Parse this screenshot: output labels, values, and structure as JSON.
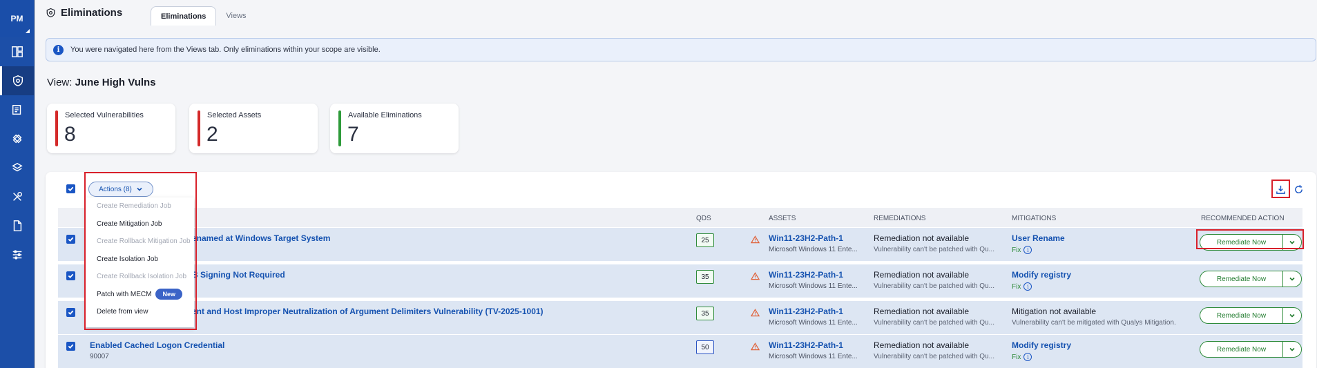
{
  "app": {
    "avatar": "PM"
  },
  "header": {
    "title": "Eliminations",
    "tabs": [
      {
        "label": "Eliminations"
      },
      {
        "label": "Views"
      }
    ]
  },
  "notice": {
    "text": "You were navigated here from the Views tab. Only eliminations within your scope are visible."
  },
  "view": {
    "prefix": "View:",
    "name": "June High Vulns"
  },
  "stats": [
    {
      "label": "Selected Vulnerabilities",
      "value": "8",
      "color": "#d42a2a"
    },
    {
      "label": "Selected Assets",
      "value": "2",
      "color": "#d42a2a"
    },
    {
      "label": "Available Eliminations",
      "value": "7",
      "color": "#2e9b3a"
    }
  ],
  "actions": {
    "label": "Actions (8)",
    "menu": [
      {
        "label": "Create Remediation Job",
        "disabled": true
      },
      {
        "label": "Create Mitigation Job",
        "disabled": false
      },
      {
        "label": "Create Rollback Mitigation Job",
        "disabled": true
      },
      {
        "label": "Create Isolation Job",
        "disabled": false
      },
      {
        "label": "Create Rollback Isolation Job",
        "disabled": true
      },
      {
        "label": "Patch with MECM",
        "disabled": false,
        "badge": "New"
      },
      {
        "label": "Delete from view",
        "disabled": false
      }
    ]
  },
  "table": {
    "headers": {
      "qds": "QDS",
      "assets": "ASSETS",
      "remediations": "REMEDIATIONS",
      "mitigations": "MITIGATIONS",
      "recommended": "RECOMMENDED ACTION"
    },
    "rows": [
      {
        "title": "enamed at Windows Target System",
        "id": "",
        "qds": "25",
        "asset": "Win11-23H2-Path-1",
        "os": "Microsoft Windows 11 Ente...",
        "rem_title": "Remediation not available",
        "rem_sub": "Vulnerability can't be patched with Qu...",
        "mit_title": "User Rename",
        "mit_sub": "Fix",
        "mit_link": true,
        "action": "Remediate Now"
      },
      {
        "title": "B Signing Not Required",
        "id": "",
        "qds": "35",
        "asset": "Win11-23H2-Path-1",
        "os": "Microsoft Windows 11 Ente...",
        "rem_title": "Remediation not available",
        "rem_sub": "Vulnerability can't be patched with Qu...",
        "mit_title": "Modify registry",
        "mit_sub": "Fix",
        "mit_link": true,
        "action": "Remediate Now"
      },
      {
        "title": "ent and Host Improper Neutralization of Argument Delimiters Vulnerability (TV-2025-1001)",
        "id": "",
        "qds": "35",
        "asset": "Win11-23H2-Path-1",
        "os": "Microsoft Windows 11 Ente...",
        "rem_title": "Remediation not available",
        "rem_sub": "Vulnerability can't be patched with Qu...",
        "mit_title": "Mitigation not available",
        "mit_sub": "Vulnerability can't be mitigated with Qualys Mitigation.",
        "mit_link": false,
        "action": "Remediate Now"
      },
      {
        "title": "Enabled Cached Logon Credential",
        "id": "90007",
        "qds": "50",
        "asset": "Win11-23H2-Path-1",
        "os": "Microsoft Windows 11 Ente...",
        "rem_title": "Remediation not available",
        "rem_sub": "Vulnerability can't be patched with Qu...",
        "mit_title": "Modify registry",
        "mit_sub": "Fix",
        "mit_link": true,
        "action": "Remediate Now"
      }
    ]
  },
  "colors": {
    "sidebar": "#1c4fa8",
    "accent": "#1552b0",
    "success": "#2e8b3a",
    "highlight_box": "#d8202a"
  }
}
